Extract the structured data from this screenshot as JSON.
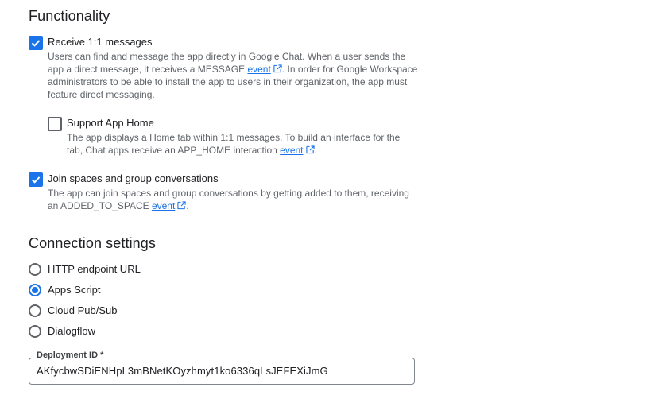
{
  "functionality": {
    "title": "Functionality",
    "receive_messages": {
      "label": "Receive 1:1 messages",
      "checked": true,
      "desc_before": "Users can find and message the app directly in Google Chat. When a user sends the app a direct message, it receives a MESSAGE ",
      "link": "event",
      "desc_after": ". In order for Google Workspace administrators to be able to install the app to users in their organization, the app must feature direct messaging."
    },
    "app_home": {
      "label": "Support App Home",
      "checked": false,
      "desc_before": "The app displays a Home tab within 1:1 messages. To build an interface for the tab, Chat apps receive an APP_HOME interaction ",
      "link": "event",
      "desc_after": "."
    },
    "join_spaces": {
      "label": "Join spaces and group conversations",
      "checked": true,
      "desc_before": "The app can join spaces and group conversations by getting added to them, receiving an ADDED_TO_SPACE ",
      "link": "event",
      "desc_after": "."
    }
  },
  "connection": {
    "title": "Connection settings",
    "options": [
      {
        "label": "HTTP endpoint URL",
        "selected": false
      },
      {
        "label": "Apps Script",
        "selected": true
      },
      {
        "label": "Cloud Pub/Sub",
        "selected": false
      },
      {
        "label": "Dialogflow",
        "selected": false
      }
    ],
    "deployment_id": {
      "label": "Deployment ID *",
      "value": "AKfycbwSDiENHpL3mBNetKOyzhmyt1ko6336qLsJEFEXiJmG"
    }
  },
  "colors": {
    "accent": "#1a73e8",
    "text": "#202124",
    "secondary_text": "#5f6368"
  }
}
